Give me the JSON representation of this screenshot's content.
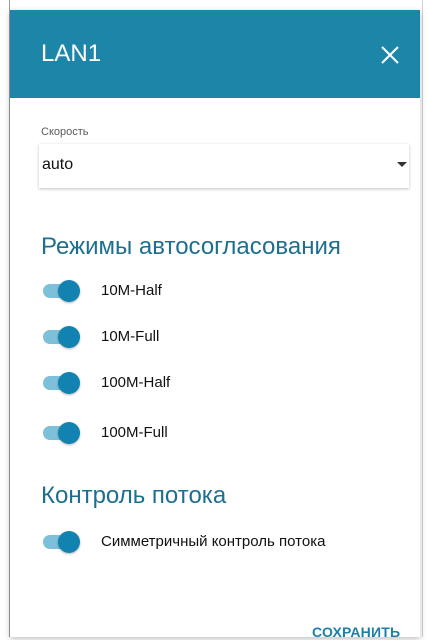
{
  "dialog": {
    "title": "LAN1",
    "close_icon": "close-icon"
  },
  "speed": {
    "label": "Скорость",
    "value": "auto"
  },
  "autoneg": {
    "title": "Режимы автосогласования",
    "modes": [
      {
        "label": "10M-Half",
        "enabled": true
      },
      {
        "label": "10M-Full",
        "enabled": true
      },
      {
        "label": "100M-Half",
        "enabled": true
      },
      {
        "label": "100M-Full",
        "enabled": true
      }
    ]
  },
  "flow": {
    "title": "Контроль потока",
    "symmetric": {
      "label": "Симметричный контроль потока",
      "enabled": true
    }
  },
  "actions": {
    "save_label": "СОХРАНИТЬ"
  },
  "colors": {
    "header": "#1d86a8",
    "accent": "#1283b0",
    "track": "#7cc0da",
    "section_title": "#1d6f90"
  }
}
